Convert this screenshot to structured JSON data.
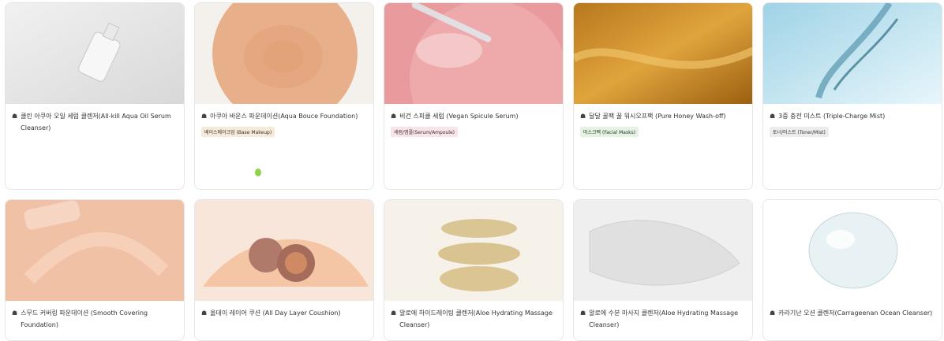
{
  "cards": [
    {
      "name": "클린 아쿠아 오일 세럼 클렌저(All-kill Aqua Oil Serum Cleanser)",
      "tag": "",
      "lock": "lock-icon"
    },
    {
      "name": "아쿠아 바운스 파운데이션(Aqua Bouce Foundation)",
      "tag": "베이스메이크업 (Base Makeup)",
      "lock": "lock-icon"
    },
    {
      "name": "비건 스피큘 세럼 (Vegan Spicule Serum)",
      "tag": "세럼/앰플(Serum/Ampoule)",
      "lock": "lock-icon"
    },
    {
      "name": "달달 꿀팩 꿀 워시오프팩 (Pure Honey Wash-off)",
      "tag": "마스크팩 (Facial Masks)",
      "lock": "lock-icon"
    },
    {
      "name": "3중 충전 미스트 (Triple-Charge Mist)",
      "tag": "토너/미스트 (Toner/Mist)",
      "lock": "lock-icon"
    },
    {
      "name": "스무드 커버링 파운데이션 (Smooth Covering Foundation)",
      "tag": "",
      "lock": "lock-icon"
    },
    {
      "name": "올데이 레이어 쿠션 (All Day Layer Coushion)",
      "tag": "",
      "lock": "lock-icon"
    },
    {
      "name": "알로에 하이드레이팅 클렌저(Aloe Hydrating Massage Cleanser)",
      "tag": "",
      "lock": "lock-icon"
    },
    {
      "name": "알로에 수분 마사지 클렌저(Aloe Hydrating Massage Cleanser)",
      "tag": "",
      "lock": "lock-icon"
    },
    {
      "name": "카라기난 오션 클렌저(Carrageenan Ocean Cleanser)",
      "tag": "",
      "lock": "lock-icon"
    }
  ],
  "colors": {
    "tag_beige": "#f6ead8",
    "tag_pink": "#fbe3ea",
    "tag_green": "#e5f3e3",
    "tag_gray": "#ececec"
  }
}
